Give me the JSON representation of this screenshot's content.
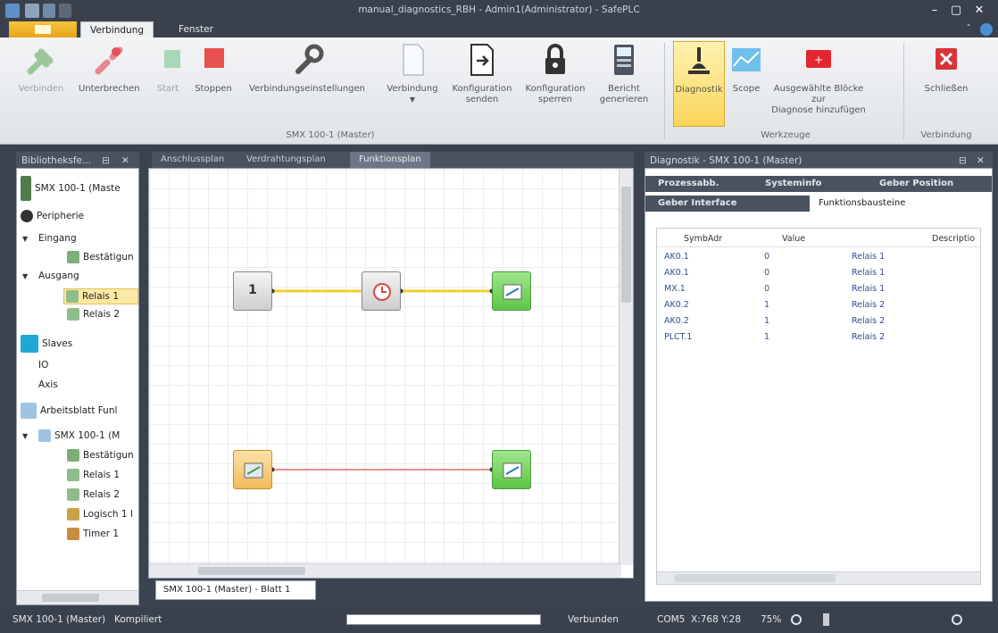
{
  "window": {
    "title": "manual_diagnostics_RBH - Admin1(Administrator) - SafePLC"
  },
  "ribbon_tabs": {
    "verbindung": "Verbindung",
    "fenster": "Fenster"
  },
  "ribbon": {
    "verbinden": "Verbinden",
    "unterbrechen": "Unterbrechen",
    "start": "Start",
    "stoppen": "Stoppen",
    "verbindungseinstellungen": "Verbindungseinstellungen",
    "verbindung_btn": "Verbindung",
    "konfig_senden_1": "Konfiguration",
    "konfig_senden_2": "senden",
    "konfig_sperren_1": "Konfiguration",
    "konfig_sperren_2": "sperren",
    "bericht_1": "Bericht",
    "bericht_2": "generieren",
    "group_connection": "SMX 100-1 (Master)",
    "diagnostik": "Diagnostik",
    "scope": "Scope",
    "ausgewaehlte_1": "Ausgewählte Blöcke zur",
    "ausgewaehlte_2": "Diagnose hinzufügen",
    "group_werkzeuge": "Werkzeuge",
    "schliessen": "Schließen",
    "group_verbindung": "Verbindung"
  },
  "left_panel": {
    "title": "Bibliotheksfe...",
    "items": [
      "SMX 100-1 (Maste",
      "Peripherie",
      "Eingang",
      "Bestätigun",
      "Ausgang",
      "Relais 1",
      "Relais 2",
      "Slaves",
      "IO",
      "Axis",
      "Arbeitsblatt Funl",
      "SMX 100-1 (M",
      "Bestätigun",
      "Relais 1",
      "Relais 2",
      "Logisch 1 I",
      "Timer 1"
    ]
  },
  "doc_tabs": {
    "anschlussplan": "Anschlussplan",
    "verdrahtungsplan": "Verdrahtungsplan",
    "funktionsplan": "Funktionsplan"
  },
  "canvas": {
    "sheet_tab": "SMX 100-1 (Master) - Blatt 1",
    "logic_value": "1"
  },
  "right_panel": {
    "title": "Diagnostik - SMX 100-1 (Master)",
    "tabs": {
      "prozessabb": "Prozessabb.",
      "systeminfo": "Systeminfo",
      "geber_position": "Geber Position",
      "geber_interface": "Geber Interface",
      "funktionsbausteine": "Funktionsbausteine"
    },
    "columns": [
      "SymbAdr",
      "Value",
      "Descriptio"
    ],
    "rows": [
      [
        "AK0.1",
        "0",
        "Relais 1"
      ],
      [
        "AK0.1",
        "0",
        "Relais 1"
      ],
      [
        "MX.1",
        "0",
        "Relais 1"
      ],
      [
        "AK0.2",
        "1",
        "Relais 2"
      ],
      [
        "AK0.2",
        "1",
        "Relais 2"
      ],
      [
        "PLCT.1",
        "1",
        "Relais 2"
      ]
    ]
  },
  "status": {
    "device": "SMX 100-1 (Master)",
    "state": "Kompiliert",
    "connection": "Verbunden",
    "port": "COM5",
    "coords": "X:768 Y:28",
    "zoom": "75%"
  }
}
